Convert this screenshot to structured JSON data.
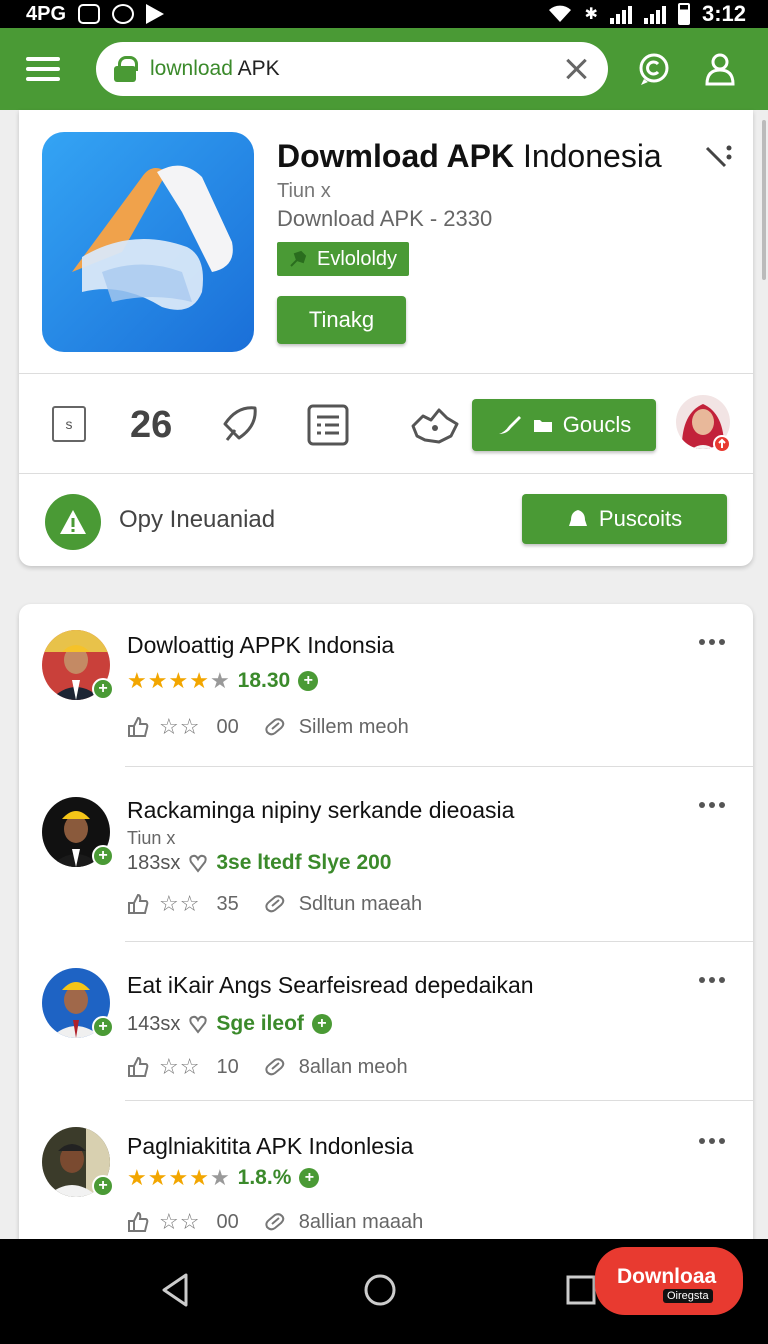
{
  "status_bar": {
    "network": "4PG",
    "time": "3:12"
  },
  "search": {
    "prefix": "lownload",
    "suffix": " APK"
  },
  "app": {
    "title_bold": "Dowmload APK",
    "title_light": " Indonesia",
    "subtitle1": "Tiun x",
    "subtitle2": "Download APK - 2330",
    "tag_label": "Evlololdy",
    "primary_button": "Tinakg"
  },
  "stats": {
    "box_label": "s",
    "count": "26",
    "action_button": "Goucls"
  },
  "warning": {
    "text": "Opy Ineuaniad",
    "button": "Puscoits"
  },
  "feed": [
    {
      "title": "Dowloattig APPK Indonsia",
      "rating": 4,
      "meta_value": "18.30",
      "action_count": "00",
      "action_text": "Sillem meoh"
    },
    {
      "title": "Rackaminga nipiny serkande dieoasia",
      "sub": "Tiun x",
      "meta_count": "183sx",
      "meta_value": "3se ltedf Slye 200",
      "action_count": "35",
      "action_text": "Sdltun maeah"
    },
    {
      "title": "Eat iKair Angs Searfeisread depedaikan",
      "meta_count": "143sx",
      "meta_value": "Sge ileof",
      "action_count": "10",
      "action_text": "8allan meoh"
    },
    {
      "title": "Paglniakitita APK Indonlesia",
      "rating": 4,
      "meta_value": "1.8.%",
      "action_count": "00",
      "action_text": "8allian maaah"
    }
  ],
  "fab": {
    "label": "Downloaa",
    "sub": "Oiregsta"
  },
  "colors": {
    "brand_green": "#4a9a35",
    "fab_red": "#e83a30",
    "star": "#f2a600"
  }
}
